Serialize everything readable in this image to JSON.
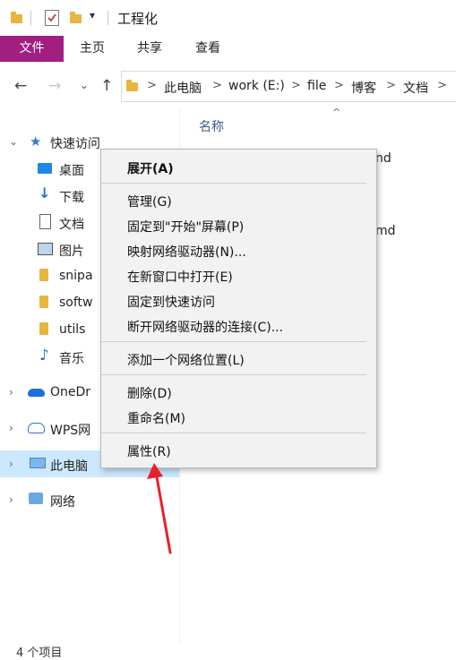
{
  "window": {
    "title": "工程化"
  },
  "ribbon": {
    "tabs": [
      "文件",
      "主页",
      "共享",
      "查看"
    ]
  },
  "address": {
    "crumbs": [
      "此电脑",
      "work (E:)",
      "file",
      "博客",
      "文档"
    ],
    "separator": ">"
  },
  "nav_pane": {
    "quick_access": "快速访问",
    "items": [
      "桌面",
      "下载",
      "文档",
      "图片",
      "snipa",
      "softw",
      "utils",
      "音乐"
    ],
    "onedrive": "OneDr",
    "wps": "WPS网",
    "this_pc": "此电脑",
    "network": "网络"
  },
  "content": {
    "column_name": "名称",
    "partial_1": "nd",
    "partial_2": "md"
  },
  "status": {
    "item_count": "4 个项目"
  },
  "context_menu": {
    "expand": "展开(A)",
    "manage": "管理(G)",
    "pin_start": "固定到\"开始\"屏幕(P)",
    "map_drive": "映射网络驱动器(N)...",
    "open_new_window": "在新窗口中打开(E)",
    "pin_quick": "固定到快速访问",
    "disconnect": "断开网络驱动器的连接(C)...",
    "add_network_location": "添加一个网络位置(L)",
    "delete": "删除(D)",
    "rename": "重命名(M)",
    "properties": "属性(R)"
  },
  "colors": {
    "file_tab": "#a01f80",
    "selection": "#cce8ff",
    "arrow": "#e8202a"
  }
}
